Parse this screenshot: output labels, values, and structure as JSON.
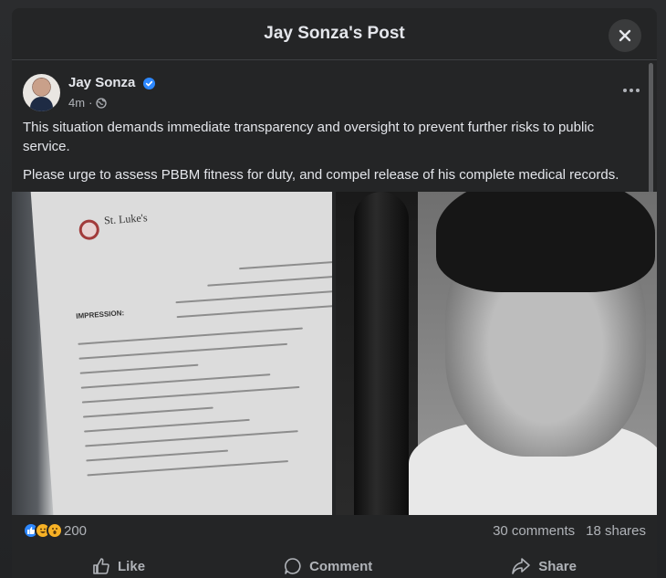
{
  "modal": {
    "title": "Jay Sonza's Post",
    "close_icon": "close-icon"
  },
  "post": {
    "author": "Jay Sonza",
    "verified": true,
    "time": "4m",
    "audience_icon": "globe-icon",
    "more_icon": "more-horizontal-icon",
    "paragraphs": [
      "This situation demands immediate transparency and oversight to prevent further risks to public service.",
      "Please urge to assess PBBM fitness for duty, and compel release of his complete medical records."
    ],
    "document_photo": {
      "hospital": "St. Luke's",
      "heading": "IMPRESSION:"
    }
  },
  "stats": {
    "reaction_count": "200",
    "comments": "30 comments",
    "shares": "18 shares"
  },
  "actions": {
    "like": "Like",
    "comment": "Comment",
    "share": "Share"
  },
  "colors": {
    "background": "#242526",
    "text_primary": "#e4e6eb",
    "text_secondary": "#b0b3b8",
    "accent_blue": "#2d88ff"
  }
}
